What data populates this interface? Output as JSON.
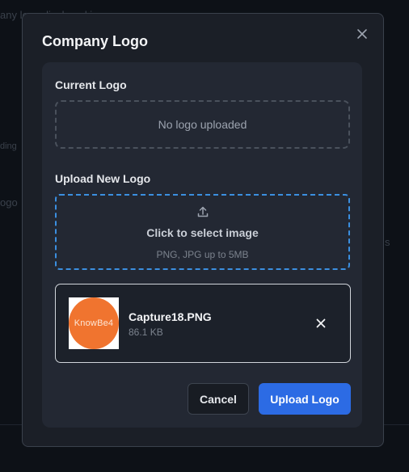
{
  "background": {
    "fragments": [
      "any logo displayed in your p",
      "ding",
      "ogo",
      "s"
    ]
  },
  "modal": {
    "title": "Company Logo",
    "close_icon": "close-icon",
    "current_logo": {
      "label": "Current Logo",
      "empty_text": "No logo uploaded"
    },
    "upload": {
      "label": "Upload New Logo",
      "icon": "upload-icon",
      "prompt": "Click to select image",
      "hint": "PNG, JPG up to 5MB"
    },
    "selected_file": {
      "thumbnail_text": "KnowBe4",
      "name": "Capture18.PNG",
      "size": "86.1 KB",
      "remove_icon": "close-icon"
    },
    "buttons": {
      "cancel": "Cancel",
      "upload": "Upload Logo"
    }
  },
  "colors": {
    "modal_bg": "#1b1f27",
    "panel_bg": "#232833",
    "accent": "#2c6be4",
    "dropzone_border": "#3b8fe0",
    "thumbnail_orange": "#f0742f"
  }
}
